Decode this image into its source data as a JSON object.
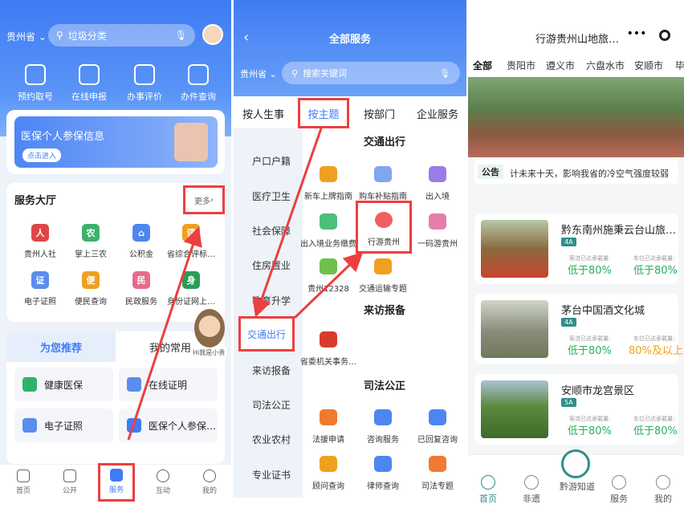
{
  "screen1": {
    "province": "贵州省",
    "search_placeholder": "垃圾分类",
    "quick": [
      "预约取号",
      "在线申报",
      "办事评价",
      "办件查询"
    ],
    "banner": "医保个人参保信息",
    "banner_btn": "点击进入",
    "hall_title": "服务大厅",
    "more": "更多",
    "services": [
      "贵州人社",
      "掌上三农",
      "公积金",
      "省综合评标…",
      "电子证照",
      "便民查询",
      "民政服务",
      "身份证网上…"
    ],
    "tab_recommend": "为您推荐",
    "tab_common": "我的常用",
    "mascot": "Hi我是小贵",
    "recs": [
      "健康医保",
      "在线证明",
      "电子证照",
      "医保个人参保…"
    ],
    "nav": [
      "首页",
      "公开",
      "服务",
      "互动",
      "我的"
    ]
  },
  "screen2": {
    "title": "全部服务",
    "province": "贵州省",
    "search_placeholder": "搜索关键词",
    "tabs": [
      "按人生事",
      "按主题",
      "按部门",
      "企业服务"
    ],
    "categories": [
      "户口户籍",
      "医疗卫生",
      "社会保障",
      "住房置业",
      "教育升学",
      "交通出行",
      "来访报备",
      "司法公正",
      "农业农村",
      "专业证书"
    ],
    "sec_traffic": "交通出行",
    "traffic": [
      "新车上牌指南",
      "购车补贴指南",
      "出入境",
      "出入境业务缴费",
      "行游贵州",
      "一码游贵州",
      "贵州12328",
      "交通运输专题"
    ],
    "sec_visit": "来访报备",
    "visit": [
      "省委机关事务…"
    ],
    "sec_law": "司法公正",
    "law": [
      "法援申请",
      "咨询服务",
      "已回复咨询",
      "顾问查询",
      "律师查询",
      "司法专题"
    ]
  },
  "screen3": {
    "title": "行游贵州山地旅…",
    "cities": [
      "全部",
      "贵阳市",
      "遵义市",
      "六盘水市",
      "安顺市",
      "毕"
    ],
    "notice_label": "公告",
    "notice": "计未来十天，影响我省的冷空气强度较弱",
    "spots": [
      {
        "name": "黔东南州施秉云台山旅…",
        "level": "4A",
        "l1": "客流已达承载量:",
        "v1": "低于80%",
        "l2": "车位已达承载量:",
        "v2": "低于80%"
      },
      {
        "name": "茅台中国酒文化城",
        "level": "4A",
        "l1": "客流已达承载量:",
        "v1": "低于80%",
        "l2": "车位已达承载量:",
        "v2": "80%及以上"
      },
      {
        "name": "安顺市龙宫景区",
        "level": "5A",
        "l1": "客流已达承载量:",
        "v1": "低于80%",
        "l2": "车位已达承载量:",
        "v2": "低于80%"
      }
    ],
    "nav": [
      "首页",
      "非遗",
      "黔游知道",
      "服务",
      "我的"
    ]
  },
  "colors": {
    "blue": "#3f7cf4",
    "red": "#ec3f40",
    "green": "#27b05e",
    "orange": "#f0a020"
  }
}
